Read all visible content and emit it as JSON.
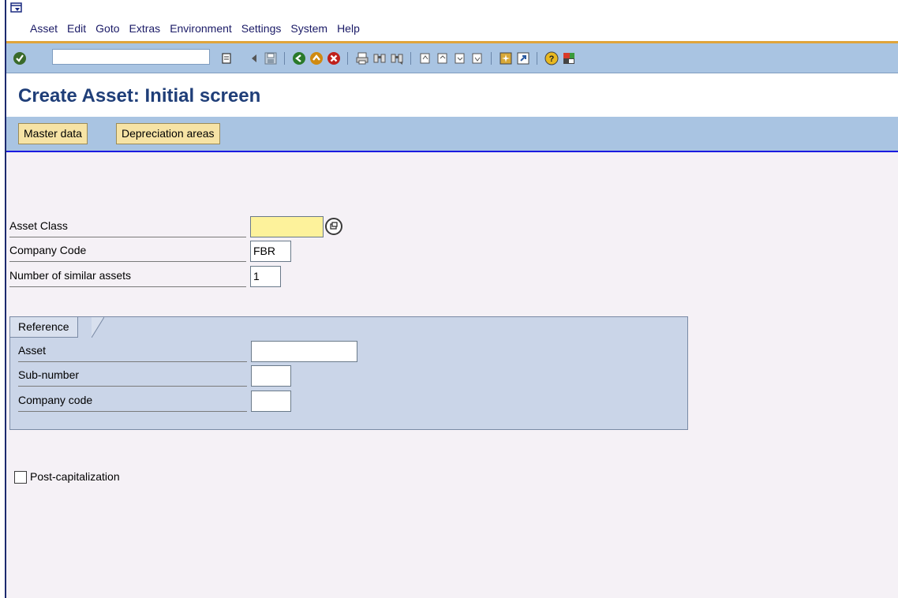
{
  "menu": {
    "items": [
      {
        "label": "Asset"
      },
      {
        "label": "Edit"
      },
      {
        "label": "Goto"
      },
      {
        "label": "Extras"
      },
      {
        "label": "Environment"
      },
      {
        "label": "Settings"
      },
      {
        "label": "System"
      },
      {
        "label": "Help"
      }
    ]
  },
  "toolbar": {
    "command_field_value": "",
    "icons": [
      "enter-icon",
      "back-arrow-icon",
      "save-icon",
      "back-icon",
      "exit-icon",
      "cancel-icon",
      "print-icon",
      "find-icon",
      "find-next-icon",
      "first-page-icon",
      "previous-page-icon",
      "next-page-icon",
      "last-page-icon",
      "create-session-icon",
      "shortcut-icon",
      "help-icon",
      "customize-layout-icon"
    ]
  },
  "title": "Create Asset: Initial screen",
  "app_buttons": {
    "master_data": "Master data",
    "depreciation_areas": "Depreciation areas"
  },
  "form": {
    "asset_class": {
      "label": "Asset Class",
      "value": ""
    },
    "company_code": {
      "label": "Company Code",
      "value": "FBR"
    },
    "similar_assets": {
      "label": "Number of similar assets",
      "value": "1"
    }
  },
  "reference": {
    "title": "Reference",
    "asset": {
      "label": "Asset",
      "value": ""
    },
    "sub_number": {
      "label": "Sub-number",
      "value": ""
    },
    "company_code": {
      "label": "Company code",
      "value": ""
    }
  },
  "post_capitalization": {
    "label": "Post-capitalization",
    "checked": false
  }
}
